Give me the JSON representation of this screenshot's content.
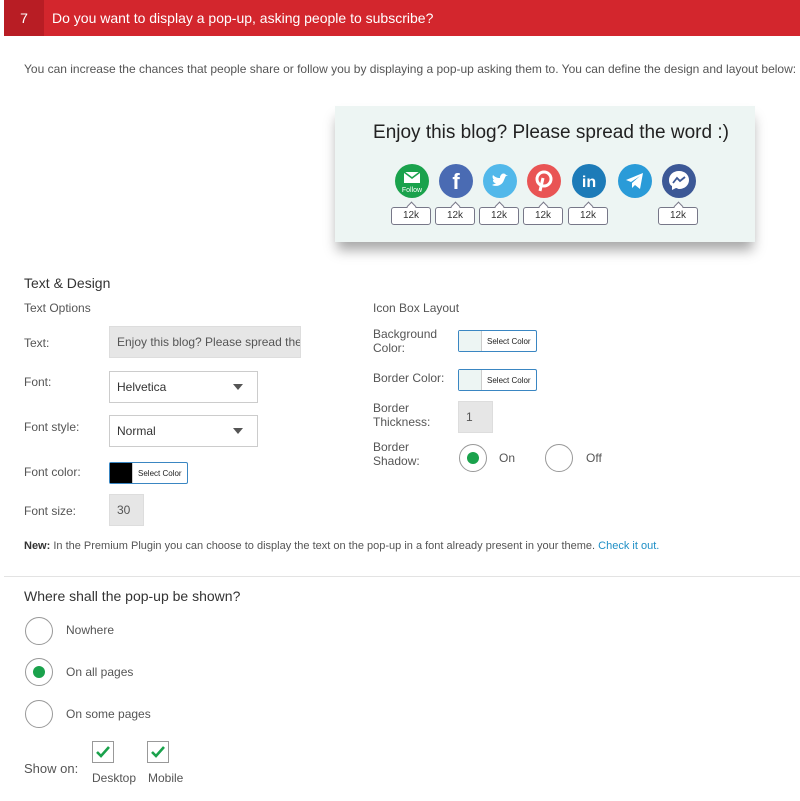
{
  "header": {
    "number": "7",
    "title": "Do you want to display a pop-up, asking people to subscribe?"
  },
  "intro": "You can increase the chances that people share or follow you by displaying a pop-up asking them to. You can define the design and layout below:",
  "preview": {
    "title": "Enjoy this blog? Please spread the word :)",
    "icons": [
      {
        "name": "email-follow-icon",
        "color": "#1aa24c",
        "label": "Follow",
        "count": "12k"
      },
      {
        "name": "facebook-icon",
        "color": "#4a6bb3",
        "count": "12k"
      },
      {
        "name": "twitter-icon",
        "color": "#52b8ea",
        "count": "12k"
      },
      {
        "name": "pinterest-icon",
        "color": "#e95454",
        "count": "12k"
      },
      {
        "name": "linkedin-icon",
        "color": "#1d7bb8",
        "count": "12k"
      },
      {
        "name": "telegram-icon",
        "color": "#2a9bd8"
      },
      {
        "name": "messenger-icon",
        "color": "#3c5896",
        "count": "12k"
      }
    ]
  },
  "text_design": {
    "title": "Text & Design",
    "text_options": "Text Options",
    "text_label": "Text:",
    "text_value": "Enjoy this blog? Please spread the word :)",
    "font_label": "Font:",
    "font_value": "Helvetica",
    "font_style_label": "Font style:",
    "font_style_value": "Normal",
    "font_color_label": "Font color:",
    "font_color_value": "#000000",
    "font_color_button": "Select Color",
    "font_size_label": "Font size:",
    "font_size_value": "30"
  },
  "icon_box": {
    "title": "Icon Box Layout",
    "bg_color_label": "Background Color:",
    "bg_color_value": "#edf5f3",
    "bg_color_button": "Select Color",
    "border_color_label": "Border Color:",
    "border_color_value": "#edf5f3",
    "border_color_button": "Select Color",
    "border_thickness_label": "Border Thickness:",
    "border_thickness_value": "1",
    "border_shadow_label": "Border Shadow:",
    "shadow_on": "On",
    "shadow_off": "Off",
    "shadow_selected": "On"
  },
  "note": {
    "prefix": "New:",
    "text": " In the Premium Plugin you can choose to display the text on the pop-up in a font already present in your theme. ",
    "link": "Check it out."
  },
  "where": {
    "title": "Where shall the pop-up be shown?",
    "options": [
      "Nowhere",
      "On all pages",
      "On some pages"
    ],
    "selected": "On all pages",
    "show_on_label": "Show on:",
    "desktop": "Desktop",
    "mobile": "Mobile"
  },
  "colors": {
    "accent": "#d3262d",
    "selected": "#1aa24c",
    "link": "#1e8fc6"
  }
}
